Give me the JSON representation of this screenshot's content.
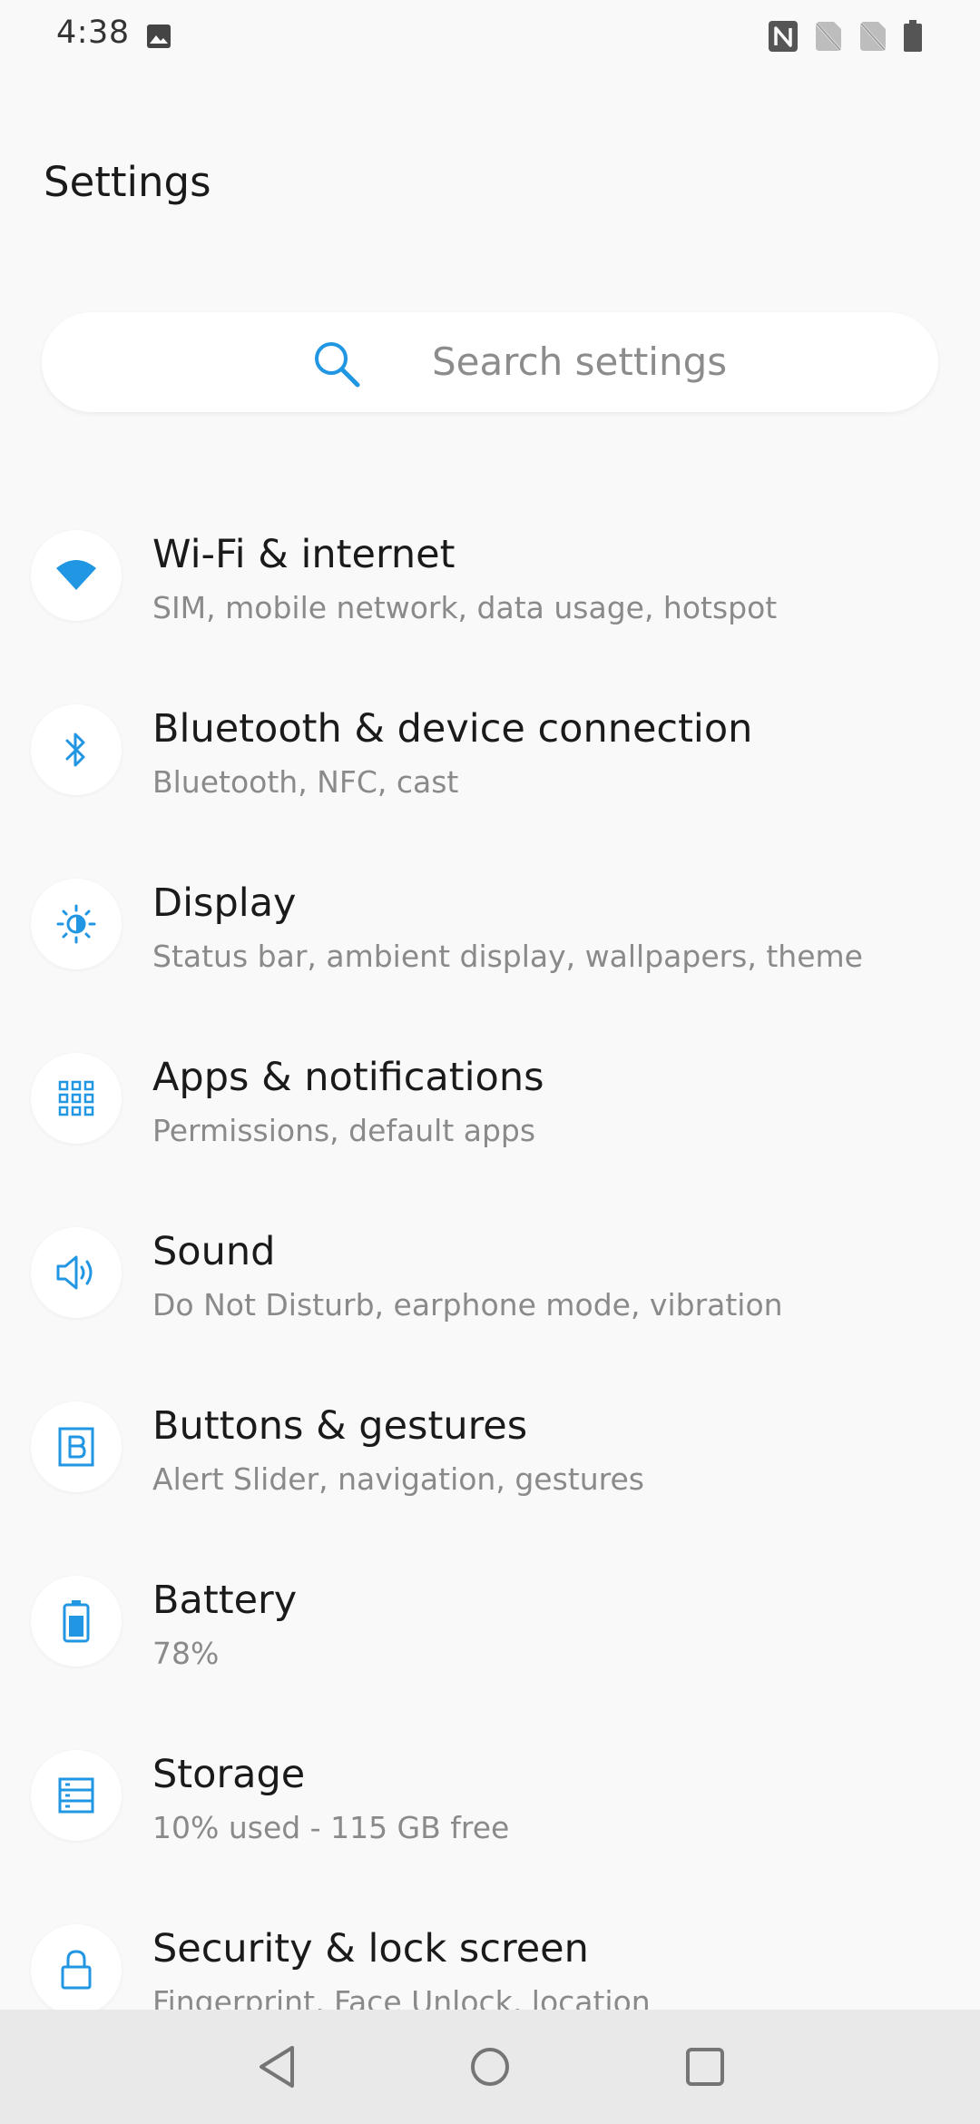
{
  "status_bar": {
    "time": "4:38",
    "left_icons": [
      "gallery-icon"
    ],
    "right_icons": [
      "nfc-icon",
      "no-sim-icon",
      "no-sim-icon",
      "battery-icon"
    ]
  },
  "header": {
    "title": "Settings"
  },
  "search": {
    "placeholder": "Search settings",
    "icon": "search-icon"
  },
  "colors": {
    "accent": "#2196e3",
    "background": "#f9f9f9",
    "title_text": "#1a1a1a",
    "subtitle_text": "#8a8a8a",
    "nav_bar": "#e9e9e9"
  },
  "settings_items": [
    {
      "title": "Wi-Fi & internet",
      "subtitle": "SIM, mobile network, data usage, hotspot",
      "icon": "wifi-icon"
    },
    {
      "title": "Bluetooth & device connection",
      "subtitle": "Bluetooth, NFC, cast",
      "icon": "bluetooth-icon"
    },
    {
      "title": "Display",
      "subtitle": "Status bar, ambient display, wallpapers, theme",
      "icon": "brightness-icon"
    },
    {
      "title": "Apps & notifications",
      "subtitle": "Permissions, default apps",
      "icon": "apps-grid-icon"
    },
    {
      "title": "Sound",
      "subtitle": "Do Not Disturb, earphone mode, vibration",
      "icon": "speaker-icon"
    },
    {
      "title": "Buttons & gestures",
      "subtitle": "Alert Slider, navigation, gestures",
      "icon": "b-button-icon"
    },
    {
      "title": "Battery",
      "subtitle": "78%",
      "icon": "battery-icon"
    },
    {
      "title": "Storage",
      "subtitle": "10% used - 115 GB free",
      "icon": "storage-icon"
    },
    {
      "title": "Security & lock screen",
      "subtitle": "Fingerprint, Face Unlock, location",
      "icon": "lock-icon"
    }
  ],
  "nav_bar": {
    "buttons": [
      "back-icon",
      "home-icon",
      "recents-icon"
    ]
  }
}
